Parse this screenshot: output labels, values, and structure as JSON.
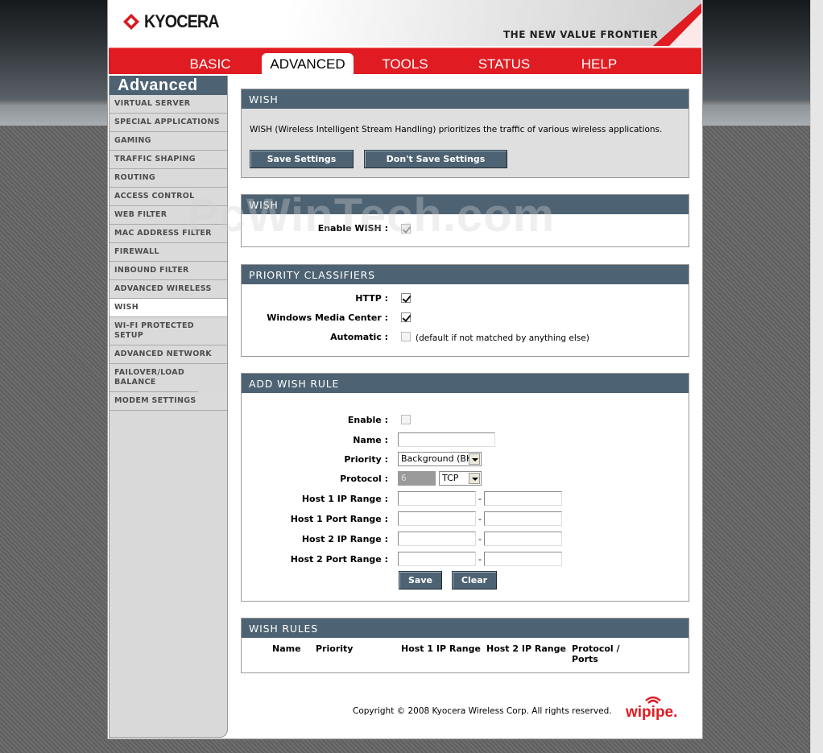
{
  "brand": {
    "logo_text": "KYOCERA",
    "tagline": "THE NEW VALUE FRONTIER",
    "accent_red": "#e01b22",
    "panel_blue": "#4d6373"
  },
  "nav": {
    "tabs": [
      {
        "label": "BASIC"
      },
      {
        "label": "ADVANCED",
        "active": true
      },
      {
        "label": "TOOLS"
      },
      {
        "label": "STATUS"
      },
      {
        "label": "HELP"
      }
    ]
  },
  "sidebar": {
    "title": "Advanced",
    "items": [
      {
        "label": "VIRTUAL SERVER"
      },
      {
        "label": "SPECIAL APPLICATIONS"
      },
      {
        "label": "GAMING"
      },
      {
        "label": "TRAFFIC SHAPING"
      },
      {
        "label": "ROUTING"
      },
      {
        "label": "ACCESS CONTROL"
      },
      {
        "label": "WEB FILTER"
      },
      {
        "label": "MAC ADDRESS FILTER"
      },
      {
        "label": "FIREWALL"
      },
      {
        "label": "INBOUND FILTER"
      },
      {
        "label": "ADVANCED WIRELESS"
      },
      {
        "label": "WISH",
        "active": true
      },
      {
        "label": "WI-FI PROTECTED SETUP"
      },
      {
        "label": "ADVANCED NETWORK"
      },
      {
        "label": "FAILOVER/LOAD BALANCE"
      },
      {
        "label": "MODEM SETTINGS"
      }
    ]
  },
  "intro": {
    "title": "WISH",
    "description": "WISH (Wireless Intelligent Stream Handling) prioritizes the traffic of various wireless applications.",
    "save_label": "Save Settings",
    "dont_save_label": "Don't Save Settings"
  },
  "wish": {
    "title": "WISH",
    "enable_label": "Enable WISH :",
    "enabled": true
  },
  "classifiers": {
    "title": "PRIORITY CLASSIFIERS",
    "http_label": "HTTP :",
    "http_checked": true,
    "wmc_label": "Windows Media Center :",
    "wmc_checked": true,
    "auto_label": "Automatic :",
    "auto_checked": false,
    "auto_note": "(default if not matched by anything else)"
  },
  "add_rule": {
    "title": "ADD WISH RULE",
    "enable_label": "Enable :",
    "name_label": "Name :",
    "name_value": "",
    "priority_label": "Priority :",
    "priority_value": "Background (BK)",
    "protocol_label": "Protocol :",
    "protocol_number": "6",
    "protocol_value": "TCP",
    "host1_ip_label": "Host 1 IP Range :",
    "host1_port_label": "Host 1 Port Range :",
    "host2_ip_label": "Host 2 IP Range :",
    "host2_port_label": "Host 2 Port Range :",
    "range_sep": "-",
    "save_label": "Save",
    "clear_label": "Clear"
  },
  "rules": {
    "title": "WISH RULES",
    "columns": [
      "Name",
      "Priority",
      "Host 1 IP Range",
      "Host 2 IP Range",
      "Protocol / Ports"
    ]
  },
  "footer": {
    "copyright": "Copyright © 2008 Kyocera Wireless Corp. All rights reserved.",
    "partner_logo": "wipipe."
  },
  "watermark": "PcWinTech.com"
}
